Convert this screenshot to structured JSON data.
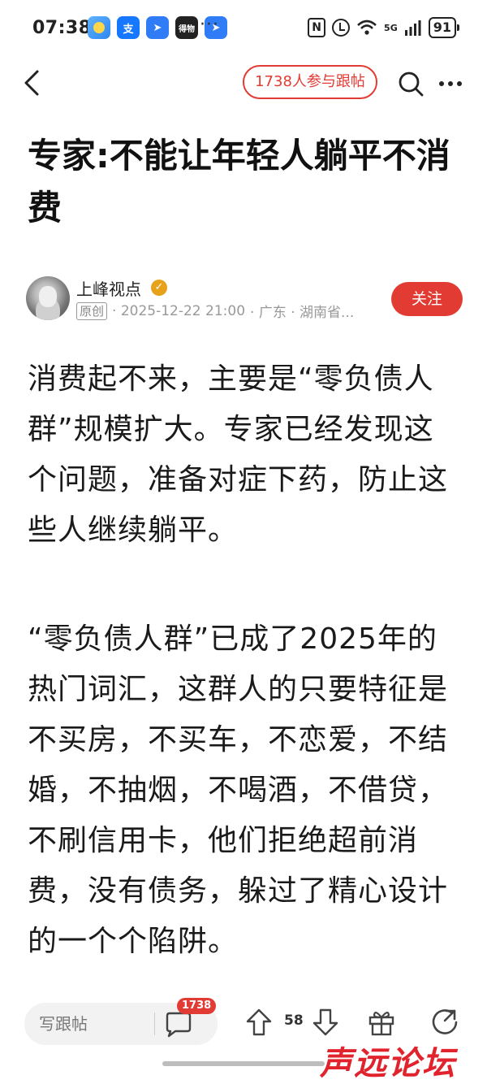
{
  "status_bar": {
    "time": "07:38",
    "more": "···",
    "network": "5G",
    "battery": "91",
    "news_app_label": "得物"
  },
  "nav": {
    "participants_pill": "1738人参与跟帖"
  },
  "article": {
    "title": "专家:不能让年轻人躺平不消费",
    "author": {
      "name": "上峰视点",
      "badge": "原创",
      "date": "· 2025-12-22 21:00",
      "location": "· 广东 · 湖南省..."
    },
    "follow_label": "关注",
    "paragraphs": [
      "消费起不来，主要是“零负债人群”规模扩大。专家已经发现这个问题，准备对症下药，防止这些人继续躺平。",
      "“零负债人群”已成了2025年的热门词汇，这群人的只要特征是不买房，不买车，不恋爱，不结婚，不抽烟，不喝酒，不借贷，不刷信用卡，他们拒绝超前消费，没有债务，躲过了精心设计的一个个陷阱。"
    ]
  },
  "bottom_bar": {
    "comment_placeholder": "写跟帖",
    "comment_count": "1738",
    "vote_count": "58"
  },
  "watermark": "声远论坛",
  "colors": {
    "accent": "#e23b33",
    "text": "#1a1a1a",
    "meta": "#999999"
  }
}
